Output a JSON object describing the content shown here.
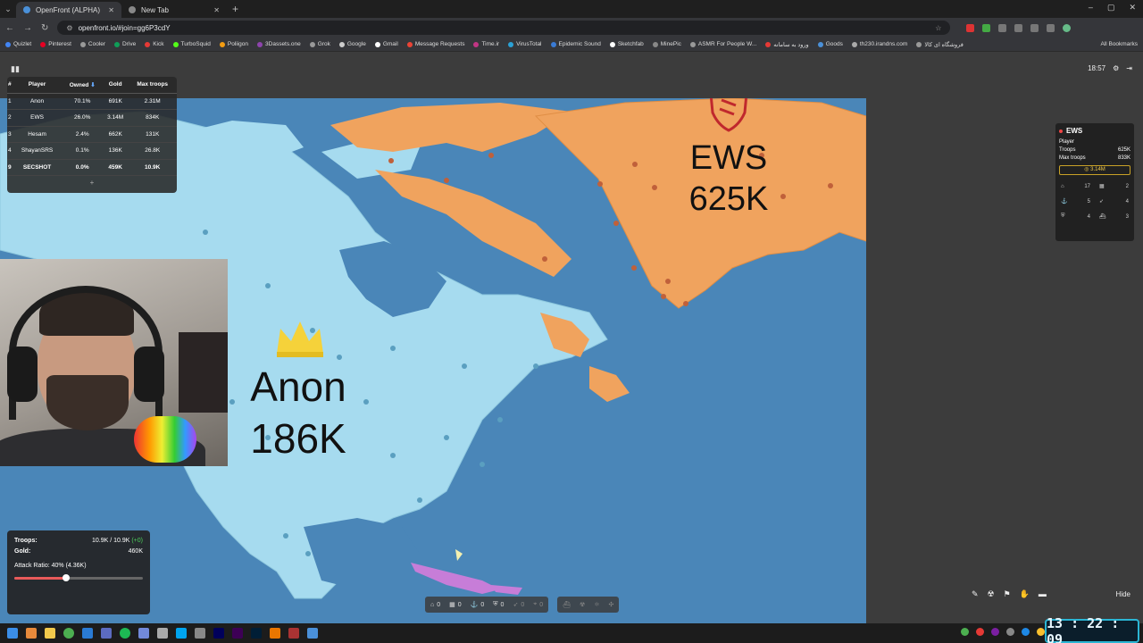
{
  "browser": {
    "tabs": [
      {
        "title": "OpenFront (ALPHA)",
        "active": true
      },
      {
        "title": "New Tab",
        "active": false
      }
    ],
    "url": "openfront.io/#join=gg6P3cdY",
    "bookmarks": [
      "Quizlet",
      "Pinterest",
      "Cooler",
      "Drive",
      "Kick",
      "TurboSquid",
      "Poliigon",
      "3Dassets.one",
      "Grok",
      "Google",
      "Gmail",
      "Message Requests",
      "Time.ir",
      "VirusTotal",
      "Epidemic Sound",
      "Sketchfab",
      "MinePic",
      "ASMR For People W...",
      "ورود به سامانه",
      "Goods",
      "th230.irandns.com",
      "فروشگاه ای کالا"
    ],
    "all_bookmarks": "All Bookmarks"
  },
  "game": {
    "time": "18:57",
    "leaderboard": {
      "headers": [
        "#",
        "Player",
        "Owned",
        "Gold",
        "Max troops"
      ],
      "rows": [
        {
          "rank": "1",
          "player": "Anon",
          "owned": "70.1%",
          "gold": "691K",
          "troops": "2.31M"
        },
        {
          "rank": "2",
          "player": "EWS",
          "owned": "26.0%",
          "gold": "3.14M",
          "troops": "834K"
        },
        {
          "rank": "3",
          "player": "Hesam",
          "owned": "2.4%",
          "gold": "662K",
          "troops": "131K"
        },
        {
          "rank": "4",
          "player": "ShayanSRS",
          "owned": "0.1%",
          "gold": "136K",
          "troops": "26.8K"
        },
        {
          "rank": "9",
          "player": "SECSHOT",
          "owned": "0.0%",
          "gold": "459K",
          "troops": "10.9K"
        }
      ],
      "expand": "+"
    },
    "map_labels": {
      "ews_name": "EWS",
      "ews_troops": "625K",
      "anon_name": "Anon",
      "anon_troops": "186K"
    },
    "player_panel": {
      "name": "EWS",
      "type": "Player",
      "troops_label": "Troops",
      "troops": "625K",
      "max_troops_label": "Max troops",
      "max_troops": "833K",
      "gold": "3.14M",
      "cells": [
        {
          "icon": "city-icon",
          "value": "17"
        },
        {
          "icon": "factory-icon",
          "value": "2"
        },
        {
          "icon": "port-icon",
          "value": "5"
        },
        {
          "icon": "missile-silo-icon",
          "value": "4"
        },
        {
          "icon": "defense-post-icon",
          "value": "4"
        },
        {
          "icon": "warship-icon",
          "value": "3"
        }
      ]
    },
    "stats": {
      "troops_label": "Troops:",
      "troops_value": "10.9K / 10.9K",
      "troops_delta": "(+0)",
      "gold_label": "Gold:",
      "gold_value": "460K",
      "attack_ratio": "Attack Ratio: 40% (4.36K)",
      "attack_ratio_fraction": 0.4
    },
    "build_bar": [
      {
        "icon": "city-icon",
        "value": "0"
      },
      {
        "icon": "factory-icon",
        "value": "0"
      },
      {
        "icon": "port-icon",
        "value": "0"
      },
      {
        "icon": "defense-post-icon",
        "value": "0"
      },
      {
        "icon": "missile-silo-icon",
        "value": "0"
      },
      {
        "icon": "sam-launcher-icon",
        "value": "0"
      }
    ],
    "tools_hide": "Hide"
  },
  "stream_clock": "13 : 22 : 09",
  "colors": {
    "ocean": "#4a86b8",
    "anon_land": "#a6dbef",
    "ews_land": "#f0a35e",
    "hesam_land": "#c77dd8"
  }
}
